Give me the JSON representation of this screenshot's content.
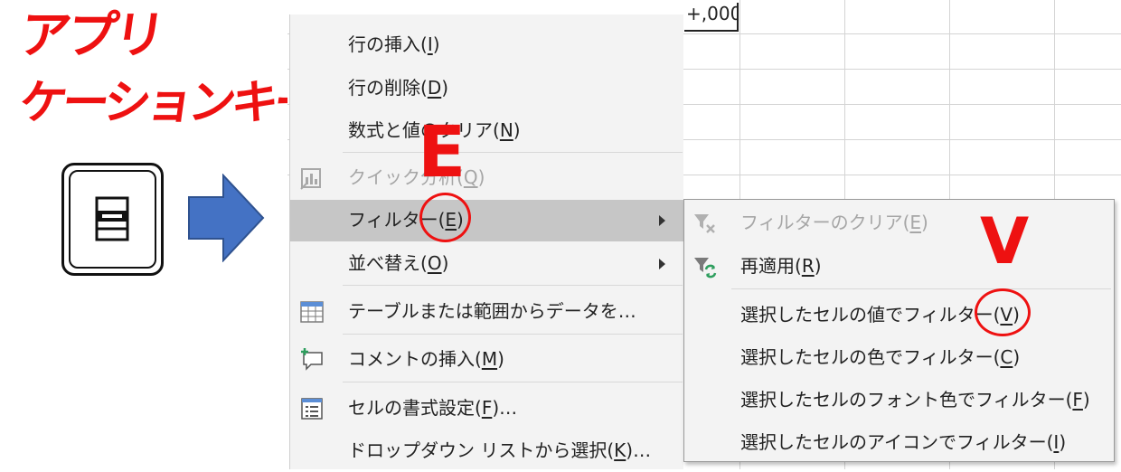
{
  "annotation": {
    "title_line1": "アプリ",
    "title_line2": "ケーションキー",
    "key_icon": "application-key-icon",
    "arrow_icon": "arrow-right-icon",
    "letter_e": "E",
    "letter_v": "V",
    "red": "#ee1111",
    "arrow_color": "#4472c4"
  },
  "sheet": {
    "cell_text": "+,000"
  },
  "context_menu": {
    "items": [
      {
        "text": "行の挿入(",
        "key": "I",
        "suffix": ")",
        "icon": ""
      },
      {
        "text": "行の削除(",
        "key": "D",
        "suffix": ")",
        "icon": ""
      },
      {
        "text": "数式と値のクリア(",
        "key": "N",
        "suffix": ")",
        "icon": ""
      },
      {
        "text": "クイック分析(",
        "key": "Q",
        "suffix": ")",
        "icon": "quick-analysis-icon",
        "disabled": true
      },
      {
        "text": "フィルター(",
        "key": "E",
        "suffix": ")",
        "icon": "",
        "submenu": true,
        "highlighted": true
      },
      {
        "text": "並べ替え(",
        "key": "O",
        "suffix": ")",
        "icon": "",
        "submenu": true
      },
      {
        "text": "テーブルまたは範囲からデータを…",
        "key": "",
        "suffix": "",
        "icon": "table-icon"
      },
      {
        "text": "コメントの挿入(",
        "key": "M",
        "suffix": ")",
        "icon": "insert-comment-icon"
      },
      {
        "text": "セルの書式設定(",
        "key": "F",
        "suffix": ")…",
        "icon": "format-cells-icon"
      },
      {
        "text": "ドロップダウン リストから選択(",
        "key": "K",
        "suffix": ")…",
        "icon": ""
      }
    ]
  },
  "filter_submenu": {
    "items": [
      {
        "text": "フィルターのクリア(",
        "key": "E",
        "suffix": ")",
        "icon": "clear-filter-icon",
        "disabled": true
      },
      {
        "text": "再適用(",
        "key": "R",
        "suffix": ")",
        "icon": "reapply-filter-icon"
      },
      {
        "text": "選択したセルの値でフィルター(",
        "key": "V",
        "suffix": ")",
        "icon": ""
      },
      {
        "text": "選択したセルの色でフィルター(",
        "key": "C",
        "suffix": ")",
        "icon": ""
      },
      {
        "text": "選択したセルのフォント色でフィルター(",
        "key": "F",
        "suffix": ")",
        "icon": ""
      },
      {
        "text": "選択したセルのアイコンでフィルター(",
        "key": "I",
        "suffix": ")",
        "icon": ""
      }
    ]
  }
}
